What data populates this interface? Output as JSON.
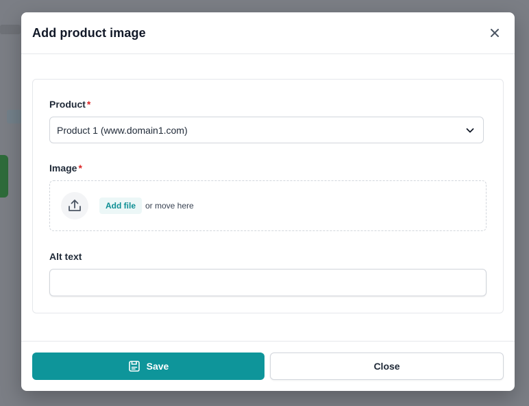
{
  "modal": {
    "title": "Add product image",
    "close_icon": "close-icon"
  },
  "form": {
    "product": {
      "label": "Product",
      "required_mark": "*",
      "selected_value": "Product 1 (www.domain1.com)"
    },
    "image": {
      "label": "Image",
      "required_mark": "*",
      "add_file_label": "Add file",
      "drop_hint": "or move here",
      "icon": "upload-icon"
    },
    "alt_text": {
      "label": "Alt text",
      "value": ""
    }
  },
  "footer": {
    "save_label": "Save",
    "save_icon": "save-icon",
    "close_label": "Close"
  },
  "colors": {
    "accent": "#0e959a",
    "required": "#dc2626",
    "overlay": "#7b7e85"
  }
}
